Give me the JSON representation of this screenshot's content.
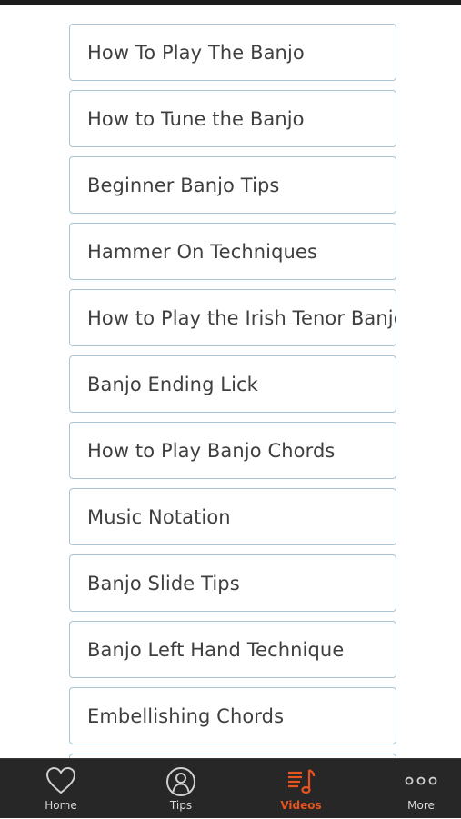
{
  "list": {
    "items": [
      {
        "label": "How To Play The Banjo"
      },
      {
        "label": "How to Tune the Banjo"
      },
      {
        "label": "Beginner Banjo Tips"
      },
      {
        "label": "Hammer On Techniques"
      },
      {
        "label": "How to Play the Irish Tenor Banjo"
      },
      {
        "label": "Banjo Ending Lick"
      },
      {
        "label": "How to Play Banjo Chords"
      },
      {
        "label": "Music Notation"
      },
      {
        "label": "Banjo Slide Tips"
      },
      {
        "label": "Banjo Left Hand Technique"
      },
      {
        "label": "Embellishing Chords"
      }
    ]
  },
  "tabbar": {
    "active_tab": "Videos",
    "accent_color": "#e8531f",
    "tabs": [
      {
        "label": "Home",
        "icon": "heart-icon"
      },
      {
        "label": "Tips",
        "icon": "person-icon"
      },
      {
        "label": "Videos",
        "icon": "music-list-icon"
      },
      {
        "label": "More",
        "icon": "more-dots-icon"
      }
    ]
  }
}
